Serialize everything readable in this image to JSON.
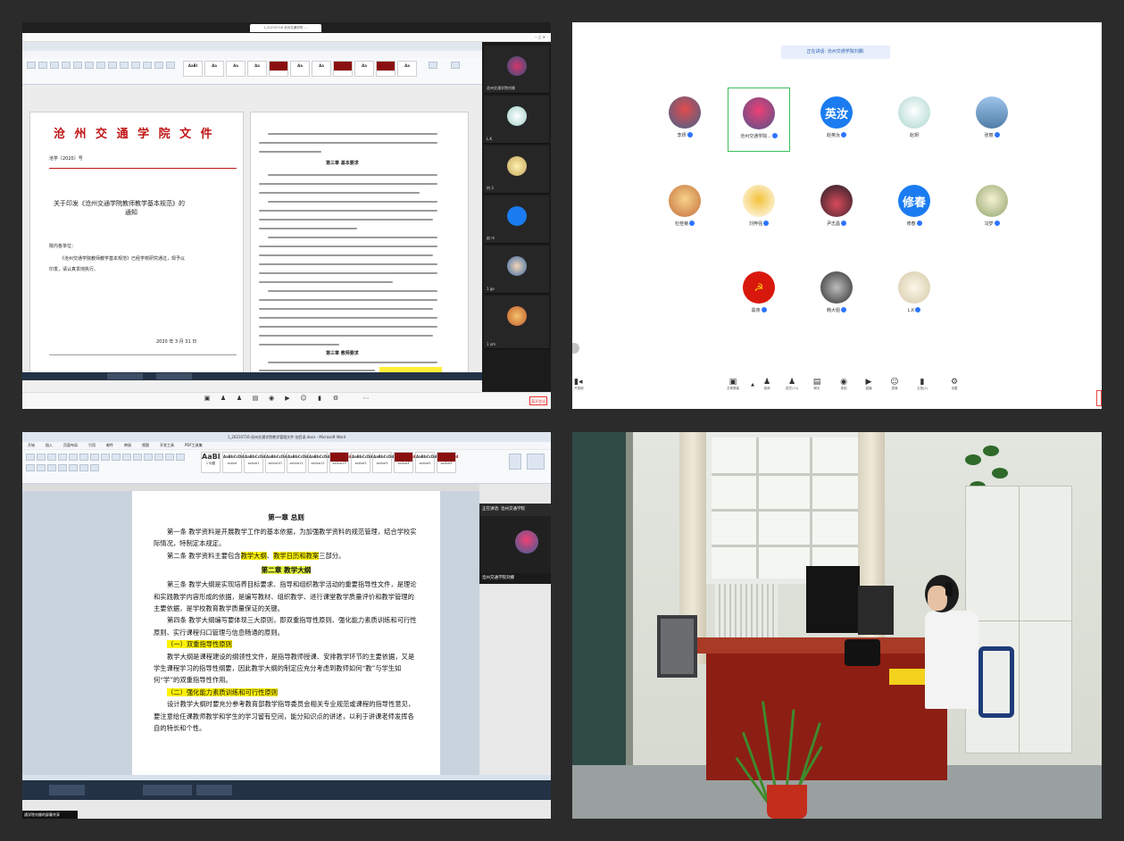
{
  "panel1": {
    "browser_tab": "1_20210716 沧州交通学院 -...",
    "doc_red_title": "沧 州 交 通 学 院 文 件",
    "doc_number": "沧学〔2020〕号",
    "doc_heading_line1": "关于印发《沧州交通学院教师教学基本规范》的",
    "doc_heading_line2": "通知",
    "doc_recipients": "院内各单位：",
    "doc_body_1": "《沧州交通学院教师教学基本规范》已经学校研究通过，现予以",
    "doc_body_2": "印发，请认真贯彻执行。",
    "doc_date": "2020 年 3 月 31 日",
    "right_heading_1": "第三章  基本要求",
    "right_heading_2": "第三章  教师要求",
    "side_labels": [
      "沧州交通学院刘娜",
      "L.K",
      "何 3",
      "赵 m",
      "1 ge",
      "1 ym"
    ],
    "leave_btn": "离开会议"
  },
  "panel2": {
    "speaking": "正在讲话: 沧州交通学院刘娜;",
    "participants": [
      {
        "name": "李妍",
        "avatar_text": "",
        "color": "#b24a4a"
      },
      {
        "name": "沧州交通学院...",
        "avatar_text": "",
        "color": "#7e3a5a"
      },
      {
        "name": "赵英汝",
        "avatar_text": "英汝",
        "color": "#1a7cf0"
      },
      {
        "name": "赵玥",
        "avatar_text": "",
        "color": "#cfd9d9"
      },
      {
        "name": "张丽",
        "avatar_text": "",
        "color": "#5c8fc9"
      },
      {
        "name": "杜桂菊",
        "avatar_text": "",
        "color": "#d08a4c"
      },
      {
        "name": "刘梓强",
        "avatar_text": "",
        "color": "#f4f4f4"
      },
      {
        "name": "尹志昌",
        "avatar_text": "",
        "color": "#333333"
      },
      {
        "name": "修春",
        "avatar_text": "修春",
        "color": "#1a7cf0"
      },
      {
        "name": "冯梦",
        "avatar_text": "",
        "color": "#dde3c0"
      },
      {
        "name": "黑夜",
        "avatar_text": "",
        "color": "#d9180d"
      },
      {
        "name": "韩大姐",
        "avatar_text": "",
        "color": "#454545"
      },
      {
        "name": "L.K",
        "avatar_text": "",
        "color": "#e8e1d0"
      }
    ],
    "toolbar": [
      {
        "label": "共享屏幕",
        "icon": "▣"
      },
      {
        "label": "邀请",
        "icon": "♟"
      },
      {
        "label": "成员(13)",
        "icon": "♟"
      },
      {
        "label": "聊天",
        "icon": "▤"
      },
      {
        "label": "录制",
        "icon": "◉"
      },
      {
        "label": "直播",
        "icon": "▶"
      },
      {
        "label": "表情",
        "icon": "☺"
      },
      {
        "label": "文档(2)",
        "icon": "▮"
      },
      {
        "label": "设置",
        "icon": "⚙"
      }
    ],
    "video_label": "开视频"
  },
  "panel3": {
    "window_title": "1_20210716-沧州交通学院教学管理文件-加目录.docx - Microsoft Word",
    "tabs": [
      "开始",
      "插入",
      "页面布局",
      "引用",
      "邮件",
      "审阅",
      "视图",
      "开发工具",
      "PDF工具集"
    ],
    "styles": [
      "AaBl",
      "AaBbCcDd",
      "AaBbCcDd",
      "AaBbCcDd",
      "AaBbCcDd",
      "AaBbCcDd",
      "AaBbCcDd",
      "AaBbCcDd",
      "AaBbCcDd",
      "AaBbCcDd",
      "AaBbCcDd",
      "AaBbCcDd"
    ],
    "style_names": [
      "1 标题",
      "active",
      "active1",
      "active10",
      "active11",
      "active12",
      "active13",
      "active2",
      "active3",
      "active4",
      "active5",
      "active9"
    ],
    "chapter1": "第一章  总则",
    "art1": "第一条  教学资料是开展教学工作的基本依据，为加强教学资料的规范管理，结合学校实际情况，特制定本规定。",
    "art2_pre": "第二条  教学资料主要包含",
    "art2_hl1": "教学大纲",
    "art2_mid": "、",
    "art2_hl2": "教学日历和教案",
    "art2_post": "三部分。",
    "chapter2": "第二章  教学大纲",
    "art3": "第三条  教学大纲是实现培养目标要求、指导和组织教学活动的重要指导性文件，是理论和实践教学内容形成的依据，是编写教材、组织教学、进行课堂教学质量评价和教学管理的主要依据，是学校教育教学质量保证的关键。",
    "art4": "第四条  教学大纲编写要体现三大原则，即双重指导性原则、强化能力素质训练和可行性原则、实行课程归口管理与信息畅通的原则。",
    "sub1": "（一）双重指导性原则",
    "para1": "教学大纲是课程建设的纲领性文件，是指导教师授课、安排教学环节的主要依据，又是学生课程学习的指导性纲要，因此教学大纲的制定应充分考虑到教师如何“教”与学生如何“学”的双重指导性作用。",
    "sub2": "（二）强化能力素质训练和可行性原则",
    "para2": "设计教学大纲时要充分参考教育部教学指导委员会相关专业规范或课程的指导性意见，要注意给任课教师教学和学生的学习留有空间，能分知识点的讲述，以利于讲课老师发挥各自的特长和个性。",
    "speaking": "正在讲话: 沧州交通学院",
    "video_name": "沧州交通学院刘娜",
    "share_label": "通学院刘娜的屏幕共享"
  }
}
